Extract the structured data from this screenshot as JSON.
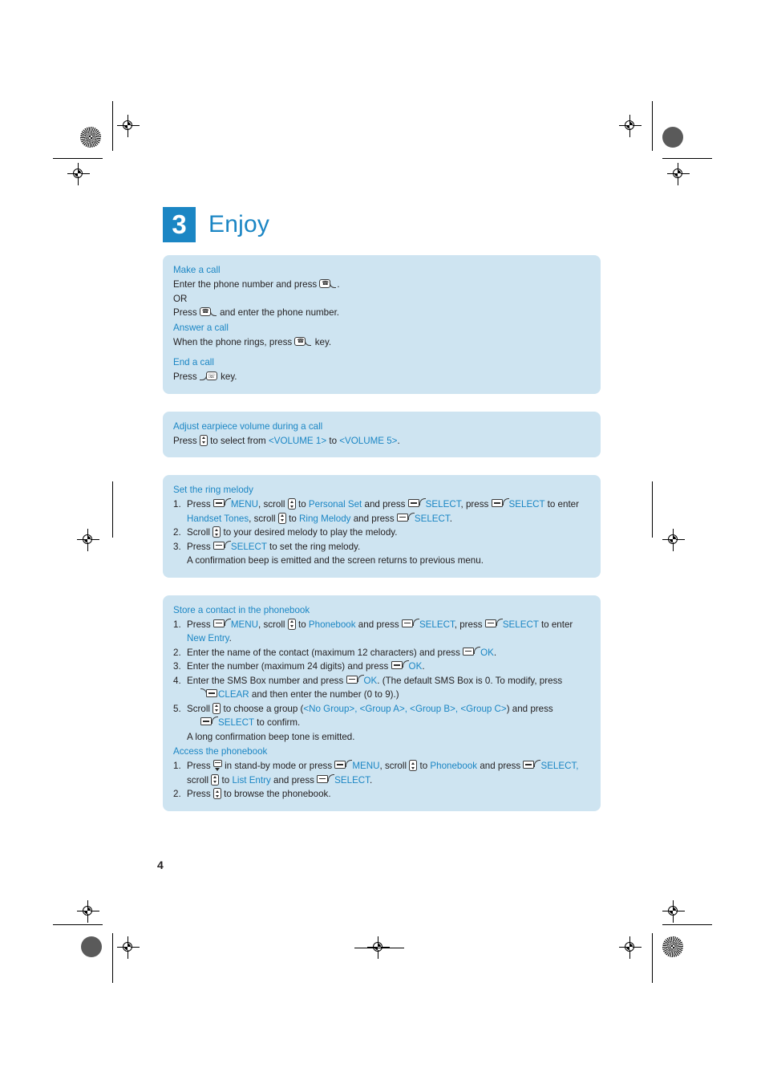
{
  "document": {
    "page_number": "4",
    "section": {
      "number": "3",
      "title": "Enjoy"
    },
    "colors": {
      "panel_background": "#cee4f1",
      "accent_blue": "#1b86c4",
      "body_text": "#231f20"
    }
  },
  "panels": [
    {
      "id": "calls",
      "blocks": {
        "make_a_call_heading": "Make a call",
        "make_a_call_line1_a": "Enter the phone number and press",
        "make_a_call_line1_b": ".",
        "make_a_call_or": "OR",
        "make_a_call_line2_a": "Press",
        "make_a_call_line2_b": "and enter the phone number.",
        "answer_a_call_heading": "Answer a call",
        "answer_a_call_line_a": "When the phone rings, press",
        "answer_a_call_line_b": "key.",
        "end_a_call_heading": "End a call",
        "end_a_call_line_a": "Press",
        "end_a_call_line_b": "key."
      }
    },
    {
      "id": "volume",
      "blocks": {
        "heading": "Adjust earpiece volume during a call",
        "line_a": "Press",
        "line_b": "to select from",
        "volume_low": "<VOLUME 1>",
        "line_c": "to",
        "volume_high": "<VOLUME 5>",
        "line_d": "."
      }
    },
    {
      "id": "ring-melody",
      "blocks": {
        "heading": "Set the ring melody",
        "step1_num": "1.",
        "step1_a": "Press",
        "step1_menu": "MENU",
        "step1_b": ", scroll",
        "step1_c": "to",
        "step1_personal_set": "Personal Set",
        "step1_d": "and press",
        "step1_select1": "SELECT",
        "step1_e": ", press",
        "step1_select2": "SELECT",
        "step1_f": "to enter",
        "step1_handset_tones": "Handset Tones",
        "step1_g": ", scroll",
        "step1_h": "to",
        "step1_ring_melody": "Ring Melody",
        "step1_i": "and press",
        "step1_select3": "SELECT",
        "step1_j": ".",
        "step2_num": "2.",
        "step2_a": "Scroll",
        "step2_b": "to your desired melody to play the melody.",
        "step3_num": "3.",
        "step3_a": "Press",
        "step3_select": "SELECT",
        "step3_b": "to set the ring melody.",
        "step3_note": "A confirmation beep is emitted and the screen returns to previous menu."
      }
    },
    {
      "id": "phonebook",
      "blocks": {
        "store_heading": "Store a contact in the phonebook",
        "s1_num": "1.",
        "s1_a": "Press",
        "s1_menu": "MENU",
        "s1_b": ", scroll",
        "s1_c": "to",
        "s1_phonebook": "Phonebook",
        "s1_d": "and press",
        "s1_select1": "SELECT",
        "s1_e": ", press",
        "s1_select2": "SELECT",
        "s1_f": "to enter",
        "s1_new_entry": "New Entry",
        "s1_g": ".",
        "s2_num": "2.",
        "s2_a": "Enter the name of the contact (maximum 12 characters) and press",
        "s2_ok": "OK",
        "s2_b": ".",
        "s3_num": "3.",
        "s3_a": "Enter the number (maximum 24 digits) and press",
        "s3_ok": "OK",
        "s3_b": ".",
        "s4_num": "4.",
        "s4_a": "Enter the SMS Box number and press",
        "s4_ok": "OK",
        "s4_b": ". (The default SMS Box is 0. To modify, press",
        "s4_clear": "CLEAR",
        "s4_c": "and then enter the number (0 to 9).)",
        "s5_num": "5.",
        "s5_a": "Scroll",
        "s5_b": "to choose a group (",
        "s5_g0": "<No Group>",
        "s5_sep1": ", ",
        "s5_g1": "<Group A>",
        "s5_sep2": ", ",
        "s5_g2": "<Group B>",
        "s5_sep3": ", ",
        "s5_g3": "<Group C>",
        "s5_c": ") and press",
        "s5_select": "SELECT",
        "s5_d": "to confirm.",
        "s5_note": "A long confirmation beep tone is emitted.",
        "access_heading": "Access the phonebook",
        "a1_num": "1.",
        "a1_a": "Press",
        "a1_b": "in stand-by mode or press",
        "a1_menu": "MENU",
        "a1_c": ", scroll",
        "a1_d": "to",
        "a1_phonebook": "Phonebook",
        "a1_e": "and press",
        "a1_select1": "SELECT",
        "a1_f": ",",
        "a1_g": "scroll",
        "a1_h": "to",
        "a1_list_entry": "List Entry",
        "a1_i": "and press",
        "a1_select2": "SELECT",
        "a1_j": ".",
        "a2_num": "2.",
        "a2_a": "Press",
        "a2_b": "to browse the phonebook."
      }
    }
  ],
  "icons": {
    "call_key": "call-key-icon",
    "end_key": "end-key-icon",
    "scroll_key": "scroll-up-down-key-icon",
    "down_key": "scroll-down-key-icon",
    "soft_key": "soft-key-icon",
    "clear_key": "clear-soft-key-icon"
  },
  "print_marks": {
    "registration": "registration-target",
    "density_patch": "density-patch"
  }
}
